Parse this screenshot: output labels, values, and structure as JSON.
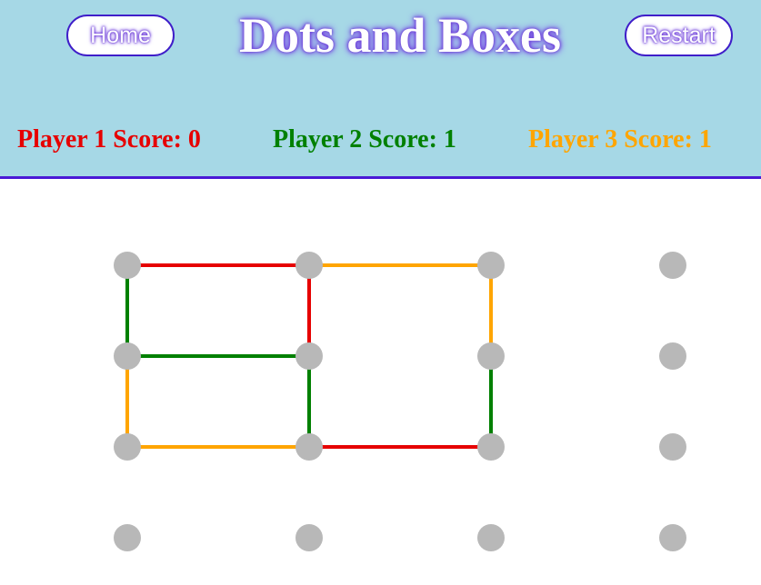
{
  "header": {
    "title": "Dots and Boxes",
    "home_label": "Home",
    "restart_label": "Restart"
  },
  "players": [
    {
      "label": "Player 1 Score: 0",
      "score": 0,
      "color": "#e60000"
    },
    {
      "label": "Player 2 Score: 1",
      "score": 1,
      "color": "#008000"
    },
    {
      "label": "Player 3 Score: 1",
      "score": 1,
      "color": "#ffa500"
    }
  ],
  "board": {
    "dot_rows": 4,
    "dot_cols": 4,
    "dot_color": "#b8b8b8",
    "lines": [
      {
        "from": [
          0,
          0
        ],
        "to": [
          0,
          1
        ],
        "player": 1
      },
      {
        "from": [
          0,
          1
        ],
        "to": [
          0,
          2
        ],
        "player": 3
      },
      {
        "from": [
          0,
          0
        ],
        "to": [
          1,
          0
        ],
        "player": 2
      },
      {
        "from": [
          0,
          1
        ],
        "to": [
          1,
          1
        ],
        "player": 1
      },
      {
        "from": [
          0,
          2
        ],
        "to": [
          1,
          2
        ],
        "player": 3
      },
      {
        "from": [
          1,
          0
        ],
        "to": [
          1,
          1
        ],
        "player": 2
      },
      {
        "from": [
          1,
          0
        ],
        "to": [
          2,
          0
        ],
        "player": 3
      },
      {
        "from": [
          1,
          1
        ],
        "to": [
          2,
          1
        ],
        "player": 2
      },
      {
        "from": [
          1,
          2
        ],
        "to": [
          2,
          2
        ],
        "player": 2
      },
      {
        "from": [
          2,
          0
        ],
        "to": [
          2,
          1
        ],
        "player": 3
      },
      {
        "from": [
          2,
          1
        ],
        "to": [
          2,
          2
        ],
        "player": 1
      }
    ]
  }
}
